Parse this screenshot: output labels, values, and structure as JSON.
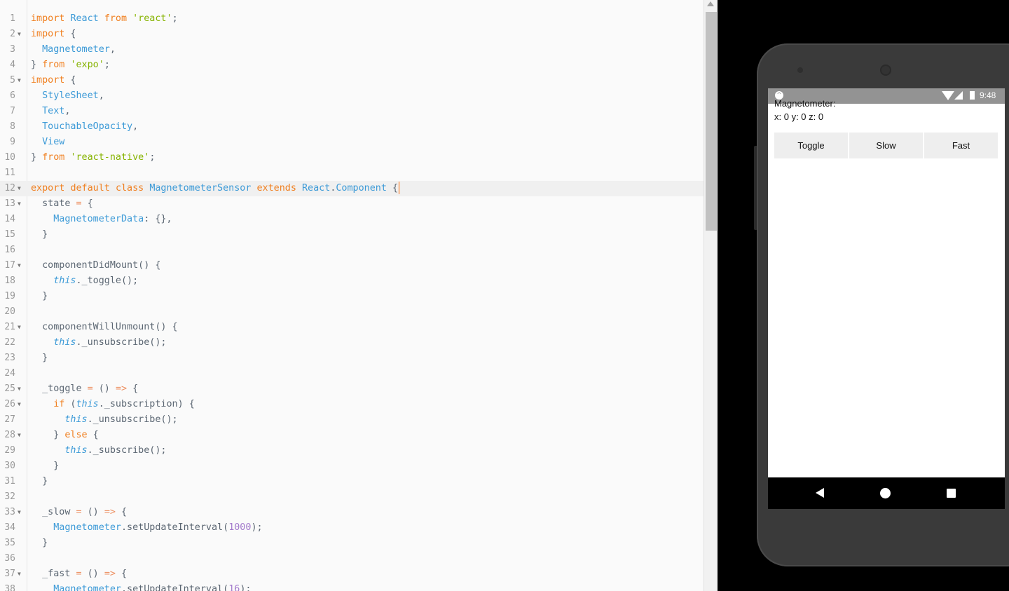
{
  "editor": {
    "lines": [
      {
        "n": "1",
        "fold": false,
        "tokens": [
          {
            "t": "import",
            "c": "kw"
          },
          {
            "t": " ",
            "c": "pl"
          },
          {
            "t": "React",
            "c": "id"
          },
          {
            "t": " ",
            "c": "pl"
          },
          {
            "t": "from",
            "c": "kw"
          },
          {
            "t": " ",
            "c": "pl"
          },
          {
            "t": "'react'",
            "c": "str"
          },
          {
            "t": ";",
            "c": "pl"
          }
        ]
      },
      {
        "n": "2",
        "fold": true,
        "tokens": [
          {
            "t": "import",
            "c": "kw"
          },
          {
            "t": " {",
            "c": "pl"
          }
        ]
      },
      {
        "n": "3",
        "fold": false,
        "tokens": [
          {
            "t": "  ",
            "c": "pl"
          },
          {
            "t": "Magnetometer",
            "c": "id"
          },
          {
            "t": ",",
            "c": "pl"
          }
        ]
      },
      {
        "n": "4",
        "fold": false,
        "tokens": [
          {
            "t": "} ",
            "c": "pl"
          },
          {
            "t": "from",
            "c": "kw"
          },
          {
            "t": " ",
            "c": "pl"
          },
          {
            "t": "'expo'",
            "c": "str"
          },
          {
            "t": ";",
            "c": "pl"
          }
        ]
      },
      {
        "n": "5",
        "fold": true,
        "tokens": [
          {
            "t": "import",
            "c": "kw"
          },
          {
            "t": " {",
            "c": "pl"
          }
        ]
      },
      {
        "n": "6",
        "fold": false,
        "tokens": [
          {
            "t": "  ",
            "c": "pl"
          },
          {
            "t": "StyleSheet",
            "c": "id"
          },
          {
            "t": ",",
            "c": "pl"
          }
        ]
      },
      {
        "n": "7",
        "fold": false,
        "tokens": [
          {
            "t": "  ",
            "c": "pl"
          },
          {
            "t": "Text",
            "c": "id"
          },
          {
            "t": ",",
            "c": "pl"
          }
        ]
      },
      {
        "n": "8",
        "fold": false,
        "tokens": [
          {
            "t": "  ",
            "c": "pl"
          },
          {
            "t": "TouchableOpacity",
            "c": "id"
          },
          {
            "t": ",",
            "c": "pl"
          }
        ]
      },
      {
        "n": "9",
        "fold": false,
        "tokens": [
          {
            "t": "  ",
            "c": "pl"
          },
          {
            "t": "View",
            "c": "id"
          }
        ]
      },
      {
        "n": "10",
        "fold": false,
        "tokens": [
          {
            "t": "} ",
            "c": "pl"
          },
          {
            "t": "from",
            "c": "kw"
          },
          {
            "t": " ",
            "c": "pl"
          },
          {
            "t": "'react-native'",
            "c": "str"
          },
          {
            "t": ";",
            "c": "pl"
          }
        ]
      },
      {
        "n": "11",
        "fold": false,
        "tokens": []
      },
      {
        "n": "12",
        "fold": true,
        "active": true,
        "caret": true,
        "tokens": [
          {
            "t": "export",
            "c": "kw"
          },
          {
            "t": " ",
            "c": "pl"
          },
          {
            "t": "default",
            "c": "kw"
          },
          {
            "t": " ",
            "c": "pl"
          },
          {
            "t": "class",
            "c": "kw"
          },
          {
            "t": " ",
            "c": "pl"
          },
          {
            "t": "MagnetometerSensor",
            "c": "id"
          },
          {
            "t": " ",
            "c": "pl"
          },
          {
            "t": "extends",
            "c": "kw"
          },
          {
            "t": " ",
            "c": "pl"
          },
          {
            "t": "React",
            "c": "id"
          },
          {
            "t": ".",
            "c": "pl"
          },
          {
            "t": "Component",
            "c": "id"
          },
          {
            "t": " {",
            "c": "pl"
          }
        ]
      },
      {
        "n": "13",
        "fold": true,
        "tokens": [
          {
            "t": "  state ",
            "c": "pl"
          },
          {
            "t": "=",
            "c": "op"
          },
          {
            "t": " {",
            "c": "pl"
          }
        ]
      },
      {
        "n": "14",
        "fold": false,
        "tokens": [
          {
            "t": "    ",
            "c": "pl"
          },
          {
            "t": "MagnetometerData",
            "c": "id"
          },
          {
            "t": ": {},",
            "c": "pl"
          }
        ]
      },
      {
        "n": "15",
        "fold": false,
        "tokens": [
          {
            "t": "  }",
            "c": "pl"
          }
        ]
      },
      {
        "n": "16",
        "fold": false,
        "tokens": []
      },
      {
        "n": "17",
        "fold": true,
        "tokens": [
          {
            "t": "  componentDidMount() {",
            "c": "pl"
          }
        ]
      },
      {
        "n": "18",
        "fold": false,
        "tokens": [
          {
            "t": "    ",
            "c": "pl"
          },
          {
            "t": "this",
            "c": "this"
          },
          {
            "t": "._toggle();",
            "c": "pl"
          }
        ]
      },
      {
        "n": "19",
        "fold": false,
        "tokens": [
          {
            "t": "  }",
            "c": "pl"
          }
        ]
      },
      {
        "n": "20",
        "fold": false,
        "tokens": []
      },
      {
        "n": "21",
        "fold": true,
        "tokens": [
          {
            "t": "  componentWillUnmount() {",
            "c": "pl"
          }
        ]
      },
      {
        "n": "22",
        "fold": false,
        "tokens": [
          {
            "t": "    ",
            "c": "pl"
          },
          {
            "t": "this",
            "c": "this"
          },
          {
            "t": "._unsubscribe();",
            "c": "pl"
          }
        ]
      },
      {
        "n": "23",
        "fold": false,
        "tokens": [
          {
            "t": "  }",
            "c": "pl"
          }
        ]
      },
      {
        "n": "24",
        "fold": false,
        "tokens": []
      },
      {
        "n": "25",
        "fold": true,
        "tokens": [
          {
            "t": "  _toggle ",
            "c": "pl"
          },
          {
            "t": "=",
            "c": "op"
          },
          {
            "t": " () ",
            "c": "pl"
          },
          {
            "t": "=>",
            "c": "op"
          },
          {
            "t": " {",
            "c": "pl"
          }
        ]
      },
      {
        "n": "26",
        "fold": true,
        "tokens": [
          {
            "t": "    ",
            "c": "pl"
          },
          {
            "t": "if",
            "c": "kw"
          },
          {
            "t": " (",
            "c": "pl"
          },
          {
            "t": "this",
            "c": "this"
          },
          {
            "t": "._subscription) {",
            "c": "pl"
          }
        ]
      },
      {
        "n": "27",
        "fold": false,
        "tokens": [
          {
            "t": "      ",
            "c": "pl"
          },
          {
            "t": "this",
            "c": "this"
          },
          {
            "t": "._unsubscribe();",
            "c": "pl"
          }
        ]
      },
      {
        "n": "28",
        "fold": true,
        "tokens": [
          {
            "t": "    } ",
            "c": "pl"
          },
          {
            "t": "else",
            "c": "kw"
          },
          {
            "t": " {",
            "c": "pl"
          }
        ]
      },
      {
        "n": "29",
        "fold": false,
        "tokens": [
          {
            "t": "      ",
            "c": "pl"
          },
          {
            "t": "this",
            "c": "this"
          },
          {
            "t": "._subscribe();",
            "c": "pl"
          }
        ]
      },
      {
        "n": "30",
        "fold": false,
        "tokens": [
          {
            "t": "    }",
            "c": "pl"
          }
        ]
      },
      {
        "n": "31",
        "fold": false,
        "tokens": [
          {
            "t": "  }",
            "c": "pl"
          }
        ]
      },
      {
        "n": "32",
        "fold": false,
        "tokens": []
      },
      {
        "n": "33",
        "fold": true,
        "tokens": [
          {
            "t": "  _slow ",
            "c": "pl"
          },
          {
            "t": "=",
            "c": "op"
          },
          {
            "t": " () ",
            "c": "pl"
          },
          {
            "t": "=>",
            "c": "op"
          },
          {
            "t": " {",
            "c": "pl"
          }
        ]
      },
      {
        "n": "34",
        "fold": false,
        "tokens": [
          {
            "t": "    ",
            "c": "pl"
          },
          {
            "t": "Magnetometer",
            "c": "id"
          },
          {
            "t": ".setUpdateInterval(",
            "c": "pl"
          },
          {
            "t": "1000",
            "c": "num"
          },
          {
            "t": ");",
            "c": "pl"
          }
        ]
      },
      {
        "n": "35",
        "fold": false,
        "tokens": [
          {
            "t": "  }",
            "c": "pl"
          }
        ]
      },
      {
        "n": "36",
        "fold": false,
        "tokens": []
      },
      {
        "n": "37",
        "fold": true,
        "tokens": [
          {
            "t": "  _fast ",
            "c": "pl"
          },
          {
            "t": "=",
            "c": "op"
          },
          {
            "t": " () ",
            "c": "pl"
          },
          {
            "t": "=>",
            "c": "op"
          },
          {
            "t": " {",
            "c": "pl"
          }
        ]
      },
      {
        "n": "38",
        "fold": false,
        "tokens": [
          {
            "t": "    ",
            "c": "pl"
          },
          {
            "t": "Magnetometer",
            "c": "id"
          },
          {
            "t": ".setUpdateInterval(",
            "c": "pl"
          },
          {
            "t": "16",
            "c": "num"
          },
          {
            "t": ");",
            "c": "pl"
          }
        ]
      }
    ]
  },
  "phone": {
    "status_time": "9:48",
    "app_icon": "expo-icon",
    "title": "Magnetometer:",
    "values": "x: 0 y: 0 z: 0",
    "buttons": [
      {
        "label": "Toggle"
      },
      {
        "label": "Slow"
      },
      {
        "label": "Fast"
      }
    ]
  },
  "colors": {
    "keyword": "#f07f1f",
    "identifier": "#3c9ad7",
    "string": "#86b300",
    "number": "#a37acc",
    "status_bar": "#939393"
  }
}
